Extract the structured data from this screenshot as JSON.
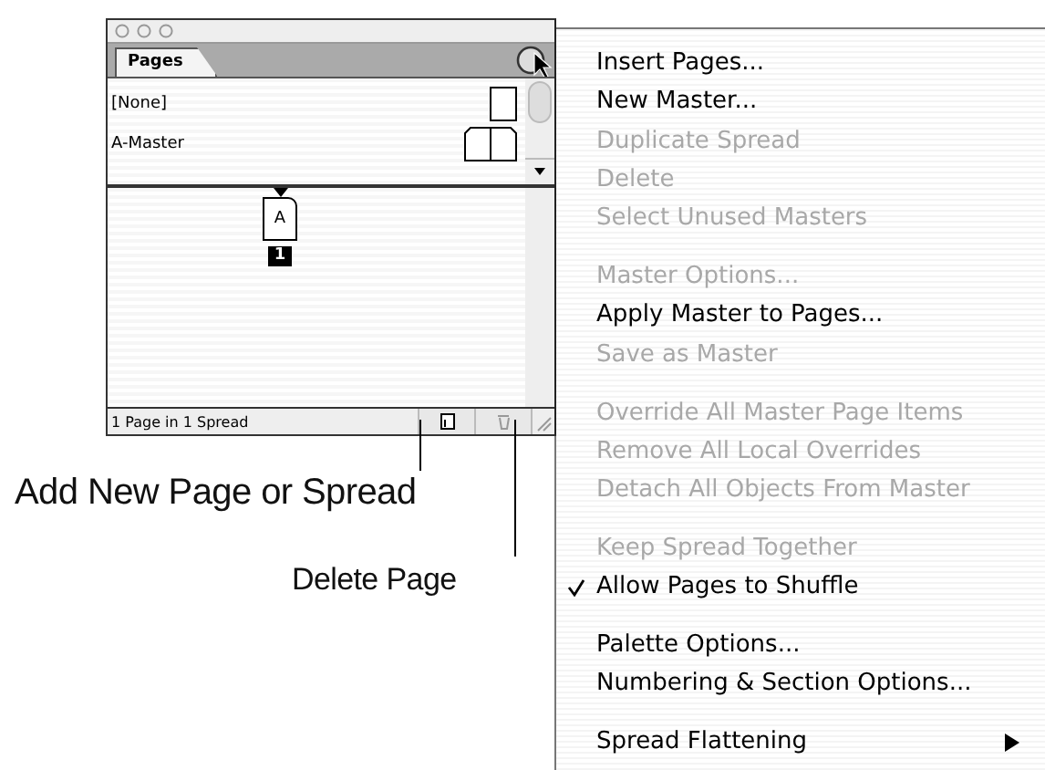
{
  "palette": {
    "tab": {
      "label": "Pages",
      "selected": true
    },
    "masters": [
      {
        "label": "[None]",
        "kind": "single"
      },
      {
        "label": "A-Master",
        "kind": "spread"
      }
    ],
    "pages": [
      {
        "master_letter": "A",
        "number": "1"
      }
    ],
    "status": "1 Page in 1 Spread"
  },
  "menu": {
    "groups": [
      [
        {
          "label": "Insert Pages...",
          "disabled": false
        },
        {
          "label": "New Master...",
          "disabled": false
        },
        {
          "label": "Duplicate Spread",
          "disabled": true
        },
        {
          "label": "Delete",
          "disabled": true
        },
        {
          "label": "Select Unused Masters",
          "disabled": true
        }
      ],
      [
        {
          "label": "Master Options...",
          "disabled": true
        },
        {
          "label": "Apply Master to Pages...",
          "disabled": false
        },
        {
          "label": "Save as Master",
          "disabled": true
        }
      ],
      [
        {
          "label": "Override All Master Page Items",
          "disabled": true
        },
        {
          "label": "Remove All Local Overrides",
          "disabled": true
        },
        {
          "label": "Detach All Objects From Master",
          "disabled": true
        }
      ],
      [
        {
          "label": "Keep Spread Together",
          "disabled": true
        },
        {
          "label": "Allow Pages to Shuffle",
          "disabled": false,
          "checked": true
        }
      ],
      [
        {
          "label": "Palette Options...",
          "disabled": false
        },
        {
          "label": "Numbering & Section Options...",
          "disabled": false
        }
      ],
      [
        {
          "label": "Spread Flattening",
          "disabled": false,
          "submenu": true
        }
      ]
    ]
  },
  "callouts": [
    {
      "text": "Add New Page or Spread",
      "kind": "new-page"
    },
    {
      "text": "Delete Page",
      "kind": "delete"
    }
  ]
}
